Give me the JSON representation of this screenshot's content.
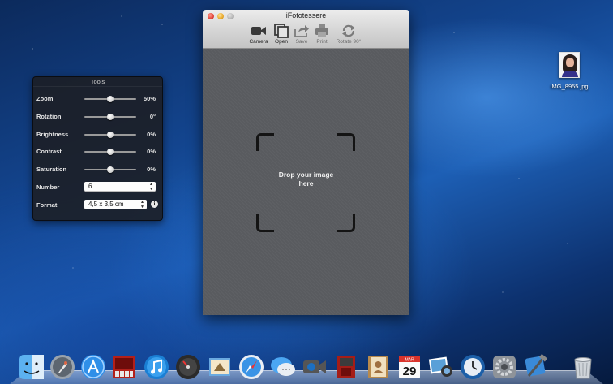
{
  "window": {
    "title": "iFototessere",
    "toolbar": [
      {
        "label": "Camera",
        "icon": "camera-icon",
        "enabled": true
      },
      {
        "label": "Open",
        "icon": "open-icon",
        "enabled": true
      },
      {
        "label": "Save",
        "icon": "save-icon",
        "enabled": false
      },
      {
        "label": "Print",
        "icon": "print-icon",
        "enabled": false
      },
      {
        "label": "Rotate 90°",
        "icon": "rotate-icon",
        "enabled": false
      }
    ],
    "dropzone": {
      "line1": "Drop your image",
      "line2": "here"
    }
  },
  "tools": {
    "title": "Tools",
    "sliders": [
      {
        "label": "Zoom",
        "value": "50%",
        "position": 0.5
      },
      {
        "label": "Rotation",
        "value": "0°",
        "position": 0.5
      },
      {
        "label": "Brightness",
        "value": "0%",
        "position": 0.5
      },
      {
        "label": "Contrast",
        "value": "0%",
        "position": 0.5
      },
      {
        "label": "Saturation",
        "value": "0%",
        "position": 0.5
      }
    ],
    "number": {
      "label": "Number",
      "value": "6"
    },
    "format": {
      "label": "Format",
      "value": "4,5 x 3,5 cm"
    }
  },
  "desktop": {
    "file": {
      "name": "IMG_8955.jpg"
    }
  },
  "dock": {
    "items": [
      "finder-icon",
      "launchpad-icon",
      "app-store-icon",
      "photo-booth-icon",
      "itunes-icon",
      "dashboard-icon",
      "mail-icon",
      "safari-icon",
      "messages-icon",
      "facetime-icon",
      "photo-booth-2-icon",
      "contacts-icon",
      "calendar-icon",
      "iphoto-icon",
      "time-machine-icon",
      "system-preferences-icon",
      "xcode-icon",
      "trash-icon"
    ],
    "calendar": {
      "month": "MAR",
      "day": "29"
    }
  },
  "colors": {
    "window_bg": "#5b5d61",
    "panel_bg": "#1c1e22",
    "accent_blue": "#1d5fb5"
  }
}
